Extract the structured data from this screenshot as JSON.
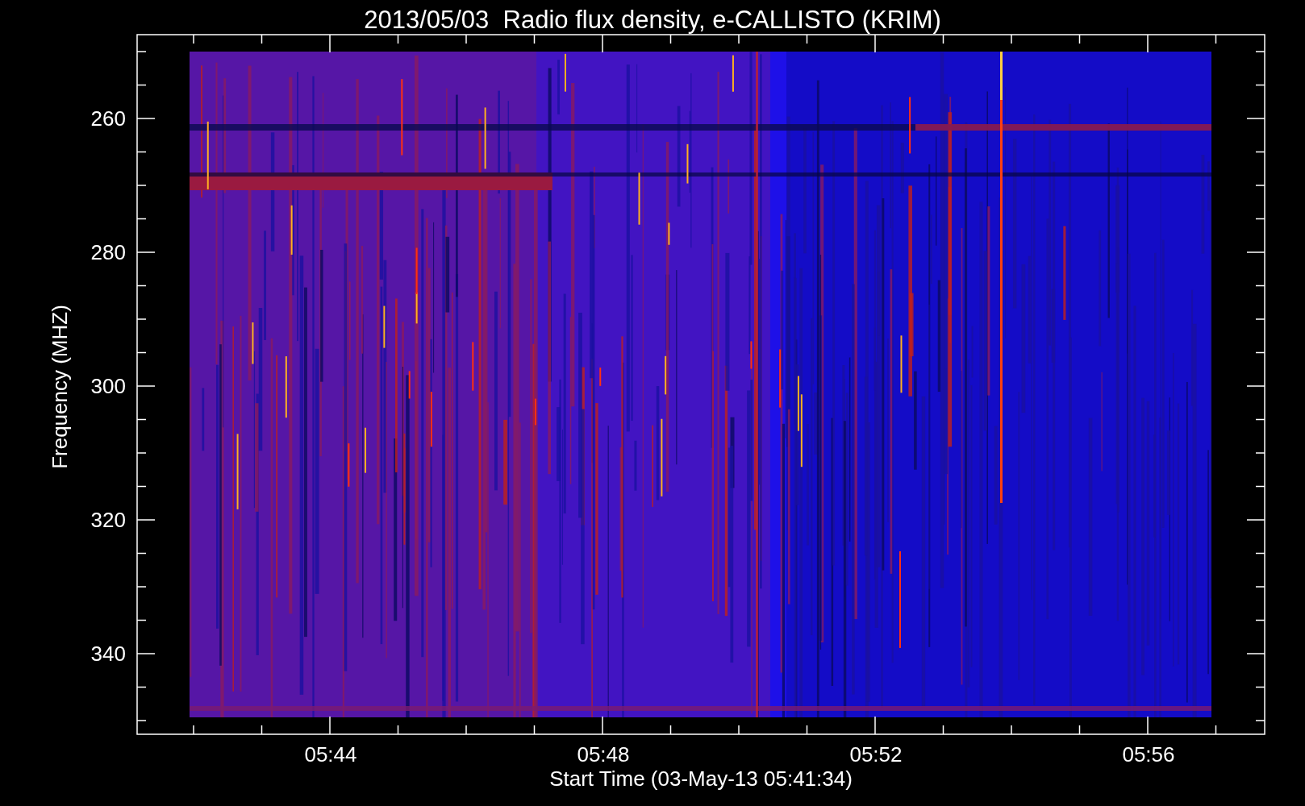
{
  "title": "2013/05/03  Radio flux density, e-CALLISTO (KRIM)",
  "y_axis": {
    "label": "Frequency (MHZ)",
    "ticks": [
      "260",
      "280",
      "300",
      "320",
      "340"
    ]
  },
  "x_axis": {
    "label": "Start Time (03-May-13 05:41:34)",
    "ticks": [
      "05:44",
      "05:48",
      "05:52",
      "05:56"
    ]
  }
}
